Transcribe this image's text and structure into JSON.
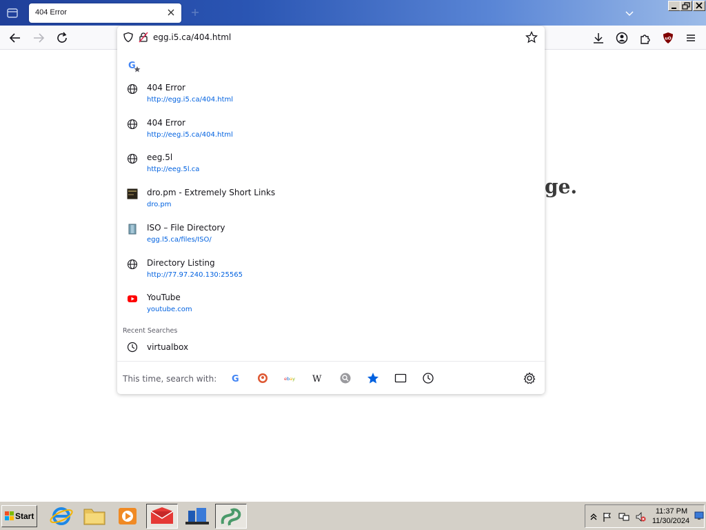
{
  "tab": {
    "title": "404 Error"
  },
  "urlbar": {
    "value": "egg.i5.ca/404.html"
  },
  "results": [
    {
      "title": "404 Error",
      "url": "http://egg.i5.ca/404.html",
      "icon": "globe-icon"
    },
    {
      "title": "404 Error",
      "url": "http://eeg.i5.ca/404.html",
      "icon": "globe-icon"
    },
    {
      "title": "eeg.5l",
      "url": "http://eeg.5l.ca",
      "icon": "globe-icon"
    },
    {
      "title": "dro.pm - Extremely Short Links",
      "url": "dro.pm",
      "icon": "dropm-favicon-icon"
    },
    {
      "title": "ISO – File Directory",
      "url": "egg.l5.ca/files/ISO/",
      "icon": "iso-favicon-icon"
    },
    {
      "title": "Directory Listing",
      "url": "http://77.97.240.130:25565",
      "icon": "globe-icon"
    },
    {
      "title": "YouTube",
      "url": "youtube.com",
      "icon": "youtube-icon"
    }
  ],
  "recent": {
    "label": "Recent Searches",
    "items": [
      "virtualbox"
    ]
  },
  "search_with": {
    "label": "This time, search with:"
  },
  "page": {
    "fragment": "ge."
  },
  "taskbar": {
    "start_label": "Start"
  },
  "clock": {
    "time": "11:37 PM",
    "date": "11/30/2024"
  },
  "colors": {
    "accent": "#0061e0",
    "tabstrip": "#2a55b3",
    "taskbar": "#d4d0c8"
  }
}
